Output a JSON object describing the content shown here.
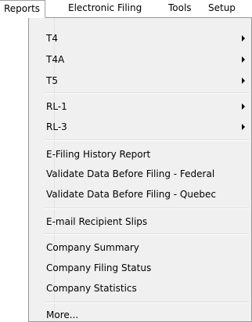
{
  "menubar": {
    "items": [
      {
        "label": "Reports"
      },
      {
        "label": "Electronic Filing"
      },
      {
        "label": "Tools"
      },
      {
        "label": "Setup"
      }
    ]
  },
  "reports_menu": {
    "items": [
      {
        "label": "T4",
        "has_submenu": true
      },
      {
        "label": "T4A",
        "has_submenu": true
      },
      {
        "label": "T5",
        "has_submenu": true
      },
      {
        "label": "RL-1",
        "has_submenu": true
      },
      {
        "label": "RL-3",
        "has_submenu": true
      },
      {
        "label": "E-Filing History Report",
        "has_submenu": false
      },
      {
        "label": "Validate Data Before Filing - Federal",
        "has_submenu": false
      },
      {
        "label": "Validate Data Before Filing - Quebec",
        "has_submenu": false
      },
      {
        "label": "E-mail Recipient Slips",
        "has_submenu": false
      },
      {
        "label": "Company Summary",
        "has_submenu": false
      },
      {
        "label": "Company Filing Status",
        "has_submenu": false
      },
      {
        "label": "Company Statistics",
        "has_submenu": false
      },
      {
        "label": "More...",
        "has_submenu": false
      }
    ]
  },
  "colors": {
    "menu_background": "#f0f0f0",
    "menu_border": "#979797",
    "separator": "#e0e0e0"
  }
}
